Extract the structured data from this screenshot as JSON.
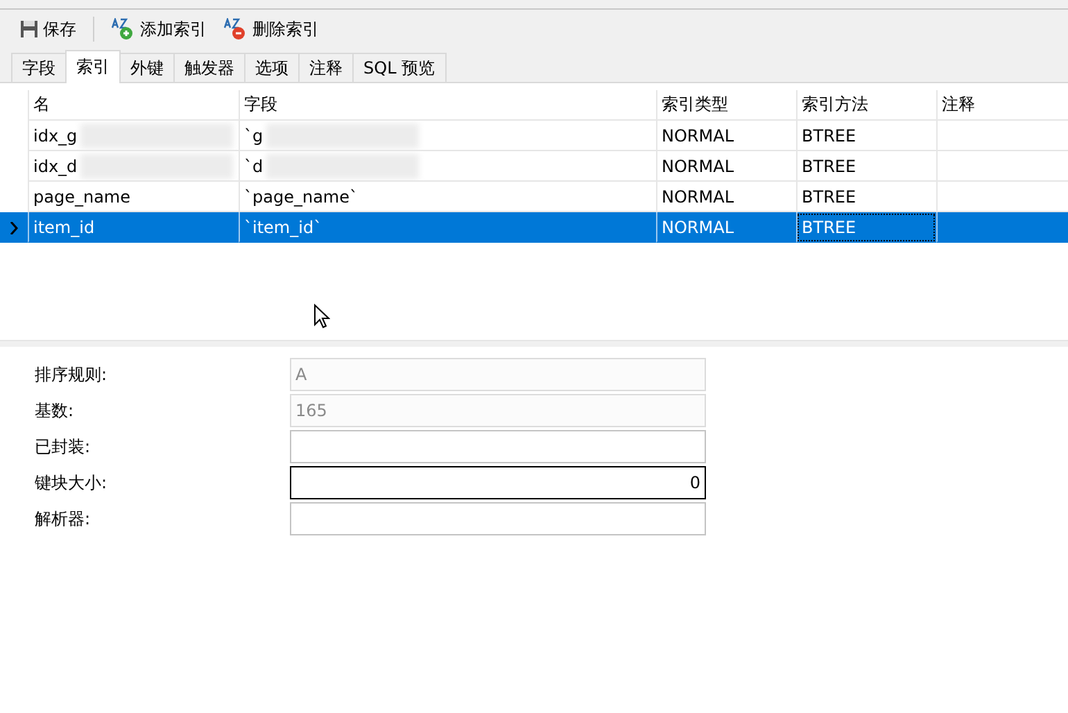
{
  "toolbar": [
    {
      "label": "保存"
    },
    {
      "label": "添加索引"
    },
    {
      "label": "删除索引"
    }
  ],
  "tabs": [
    {
      "label": "字段",
      "selected": false
    },
    {
      "label": "索引",
      "selected": true
    },
    {
      "label": "外键",
      "selected": false
    },
    {
      "label": "触发器",
      "selected": false
    },
    {
      "label": "选项",
      "selected": false
    },
    {
      "label": "注释",
      "selected": false
    },
    {
      "label": "SQL 预览",
      "selected": false
    }
  ],
  "table": {
    "columns": [
      "名",
      "字段",
      "索引类型",
      "索引方法",
      "注释"
    ],
    "rows": [
      {
        "selected": false,
        "cells": [
          {
            "text": "idx_g",
            "redacted": true
          },
          {
            "text": "`g",
            "redacted": true
          },
          {
            "text": "NORMAL"
          },
          {
            "text": "BTREE"
          },
          {}
        ]
      },
      {
        "selected": false,
        "cells": [
          {
            "text": "idx_d",
            "redacted": true
          },
          {
            "text": "`d",
            "redacted": true
          },
          {
            "text": "NORMAL"
          },
          {
            "text": "BTREE"
          },
          {}
        ]
      },
      {
        "selected": false,
        "cells": [
          {
            "text": "page_name"
          },
          {
            "text": "`page_name`"
          },
          {
            "text": "NORMAL"
          },
          {
            "text": "BTREE"
          },
          {}
        ]
      },
      {
        "selected": true,
        "cells": [
          {
            "text": "item_id"
          },
          {
            "text": "`item_id`"
          },
          {
            "text": "NORMAL"
          },
          {
            "text": "BTREE",
            "focused": true
          },
          {}
        ]
      }
    ]
  },
  "form": [
    {
      "label": "排序规则:",
      "value": "A",
      "disabled": true,
      "focused": false,
      "kind": "text"
    },
    {
      "label": "基数:",
      "value": "165",
      "disabled": true,
      "focused": false,
      "kind": "text"
    },
    {
      "label": "已封装:",
      "disabled": false,
      "focused": false,
      "kind": "text"
    },
    {
      "label": "键块大小:",
      "value": "0",
      "disabled": false,
      "focused": true,
      "kind": "number"
    },
    {
      "label": "解析器:",
      "disabled": false,
      "focused": false,
      "kind": "text"
    }
  ]
}
